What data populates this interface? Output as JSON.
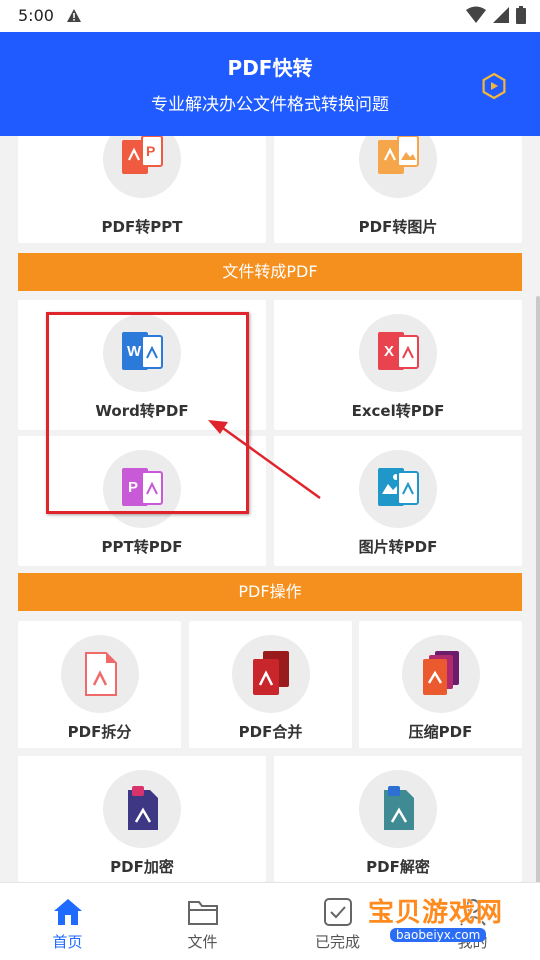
{
  "status_bar": {
    "time": "5:00"
  },
  "header": {
    "title": "PDF快转",
    "subtitle": "专业解决办公文件格式转换问题",
    "color": "#1f5bff"
  },
  "top_cards": [
    {
      "label": "PDF转PPT",
      "icon": "pdf-to-ppt-icon"
    },
    {
      "label": "PDF转图片",
      "icon": "pdf-to-image-icon"
    }
  ],
  "section_to_pdf": {
    "title": "文件转成PDF",
    "items": [
      {
        "label": "Word转PDF",
        "icon": "word-to-pdf-icon",
        "color": "#2b79d8"
      },
      {
        "label": "Excel转PDF",
        "icon": "excel-to-pdf-icon",
        "color": "#e8434e"
      },
      {
        "label": "PPT转PDF",
        "icon": "ppt-to-pdf-icon",
        "color": "#c85ad8"
      },
      {
        "label": "图片转PDF",
        "icon": "image-to-pdf-icon",
        "color": "#1f97c8"
      }
    ]
  },
  "section_pdf_ops": {
    "title": "PDF操作",
    "items": [
      {
        "label": "PDF拆分",
        "icon": "pdf-split-icon"
      },
      {
        "label": "PDF合并",
        "icon": "pdf-merge-icon"
      },
      {
        "label": "压缩PDF",
        "icon": "pdf-compress-icon"
      },
      {
        "label": "PDF加密",
        "icon": "pdf-encrypt-icon"
      },
      {
        "label": "PDF解密",
        "icon": "pdf-decrypt-icon"
      }
    ]
  },
  "section_color": "#f5901e",
  "bottom_nav": [
    {
      "label": "首页",
      "icon": "home-icon",
      "active": true
    },
    {
      "label": "文件",
      "icon": "folder-icon",
      "active": false
    },
    {
      "label": "已完成",
      "icon": "completed-icon",
      "active": false
    },
    {
      "label": "我的",
      "icon": "profile-icon",
      "active": false
    }
  ],
  "watermark": {
    "text": "宝贝游戏网",
    "url": "baobeiyx.com"
  }
}
